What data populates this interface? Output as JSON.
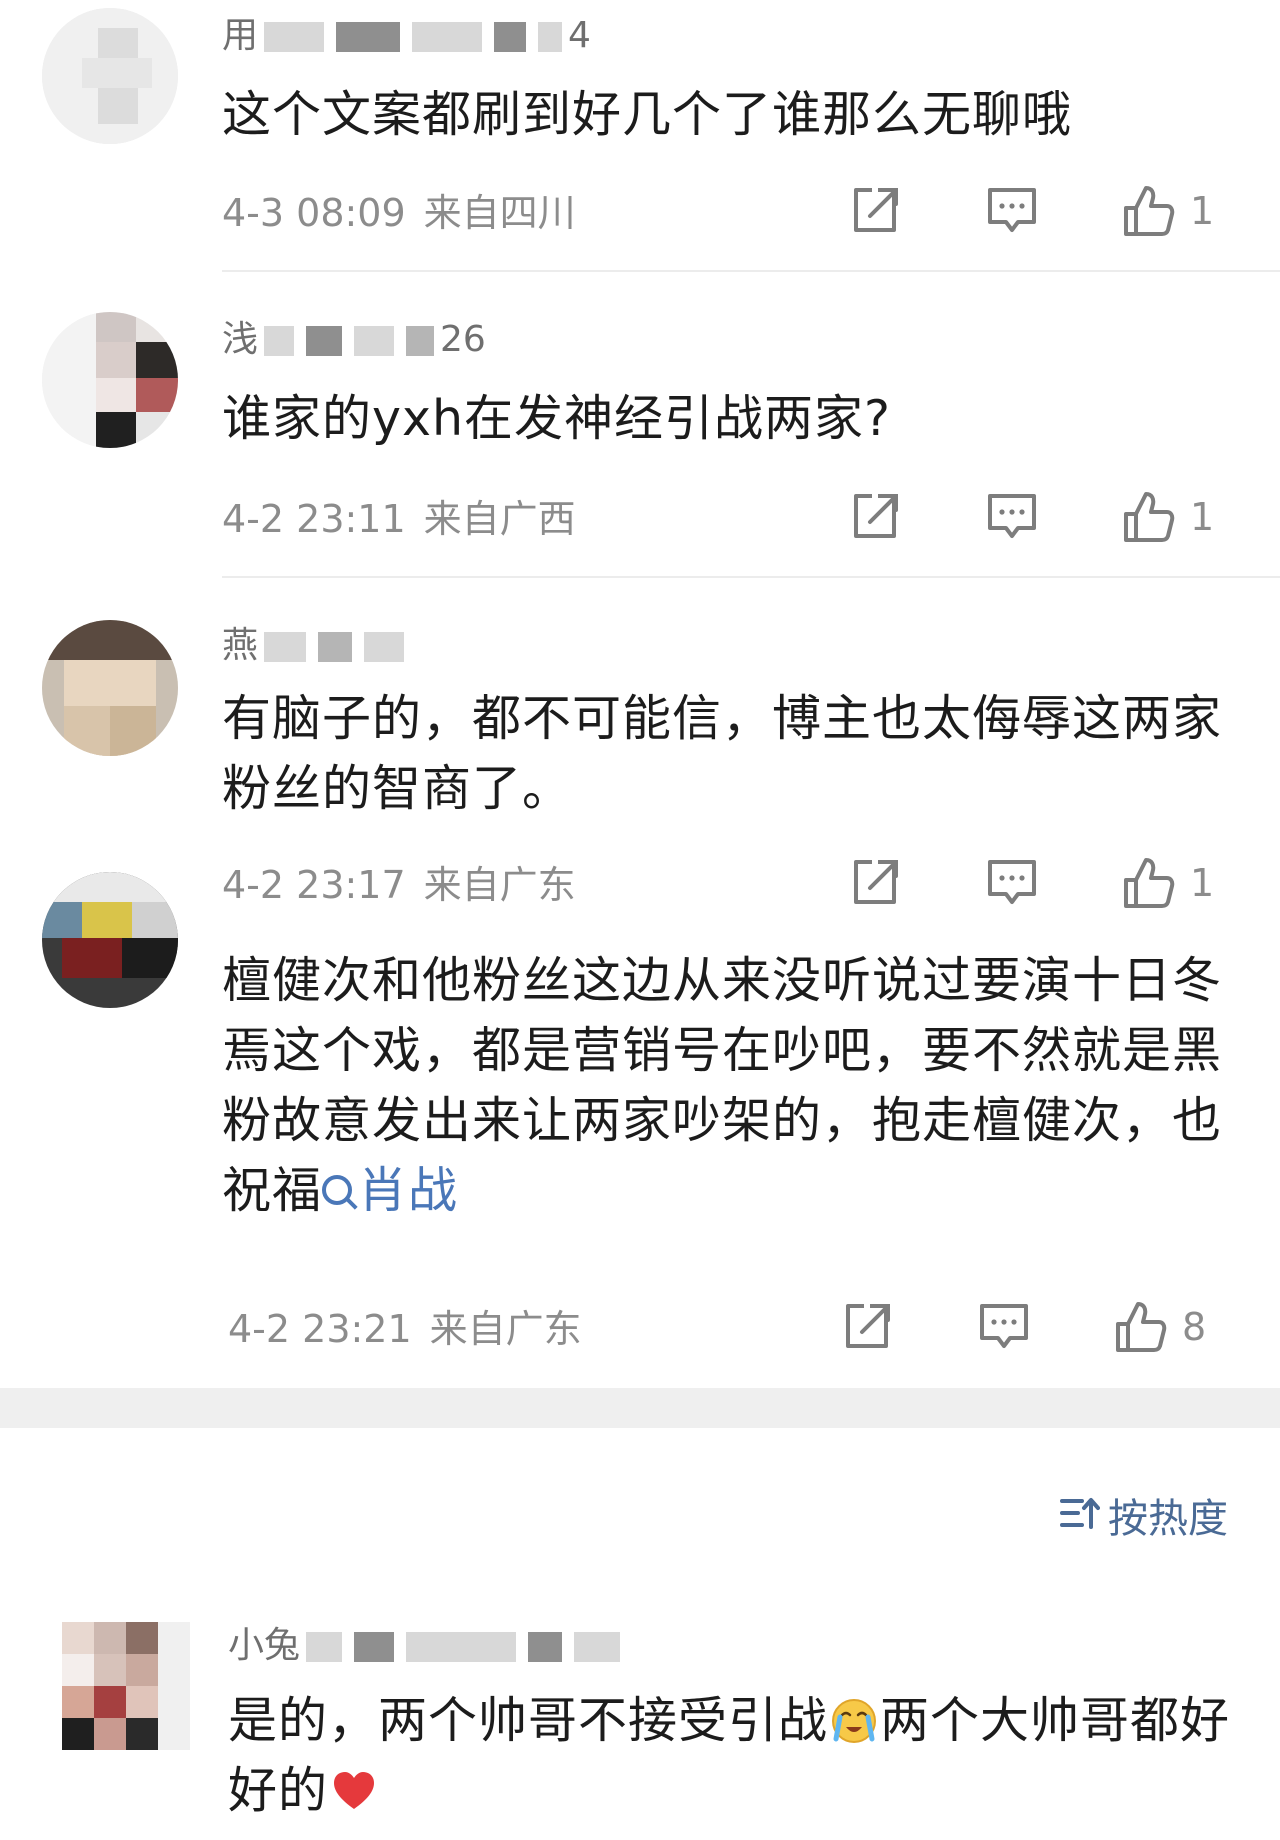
{
  "comments": [
    {
      "username_visible": [
        "用",
        "4"
      ],
      "text": "这个文案都刷到好几个了谁那么无聊哦",
      "date": "4-3 08:09",
      "location": "来自四川",
      "likes": "1"
    },
    {
      "username_visible": [
        "浅",
        "26"
      ],
      "text": "谁家的yxh在发神经引战两家?",
      "date": "4-2 23:11",
      "location": "来自广西",
      "likes": "1"
    },
    {
      "username_visible": [
        "燕",
        ""
      ],
      "text": "有脑子的，都不可能信，博主也太侮辱这两家粉丝的智商了。",
      "date": "4-2 23:17",
      "location": "来自广东",
      "likes": "1"
    },
    {
      "username_visible": [
        "",
        ""
      ],
      "text": "檀健次和他粉丝这边从来没听说过要演十日冬焉这个戏，都是营销号在吵吧，要不然就是黑粉故意发出来让两家吵架的，抱走檀健次，也祝福",
      "topic": "肖战",
      "date": "4-2 23:21",
      "location": "来自广东",
      "likes": "8"
    }
  ],
  "sort": {
    "label": "按热度"
  },
  "hot_comment": {
    "username_visible": "小兔",
    "text_part1": "是的，两个帅哥不接受引战",
    "emoji1": "crying-face-emoji",
    "text_part2": "两个大帅哥都好好的",
    "emoji2": "red-heart-emoji"
  },
  "colors": {
    "topic_link": "#4a77b8",
    "meta_gray": "#8c8c8c",
    "sort_blue": "#4a6a95",
    "section_gap": "#efefef"
  }
}
